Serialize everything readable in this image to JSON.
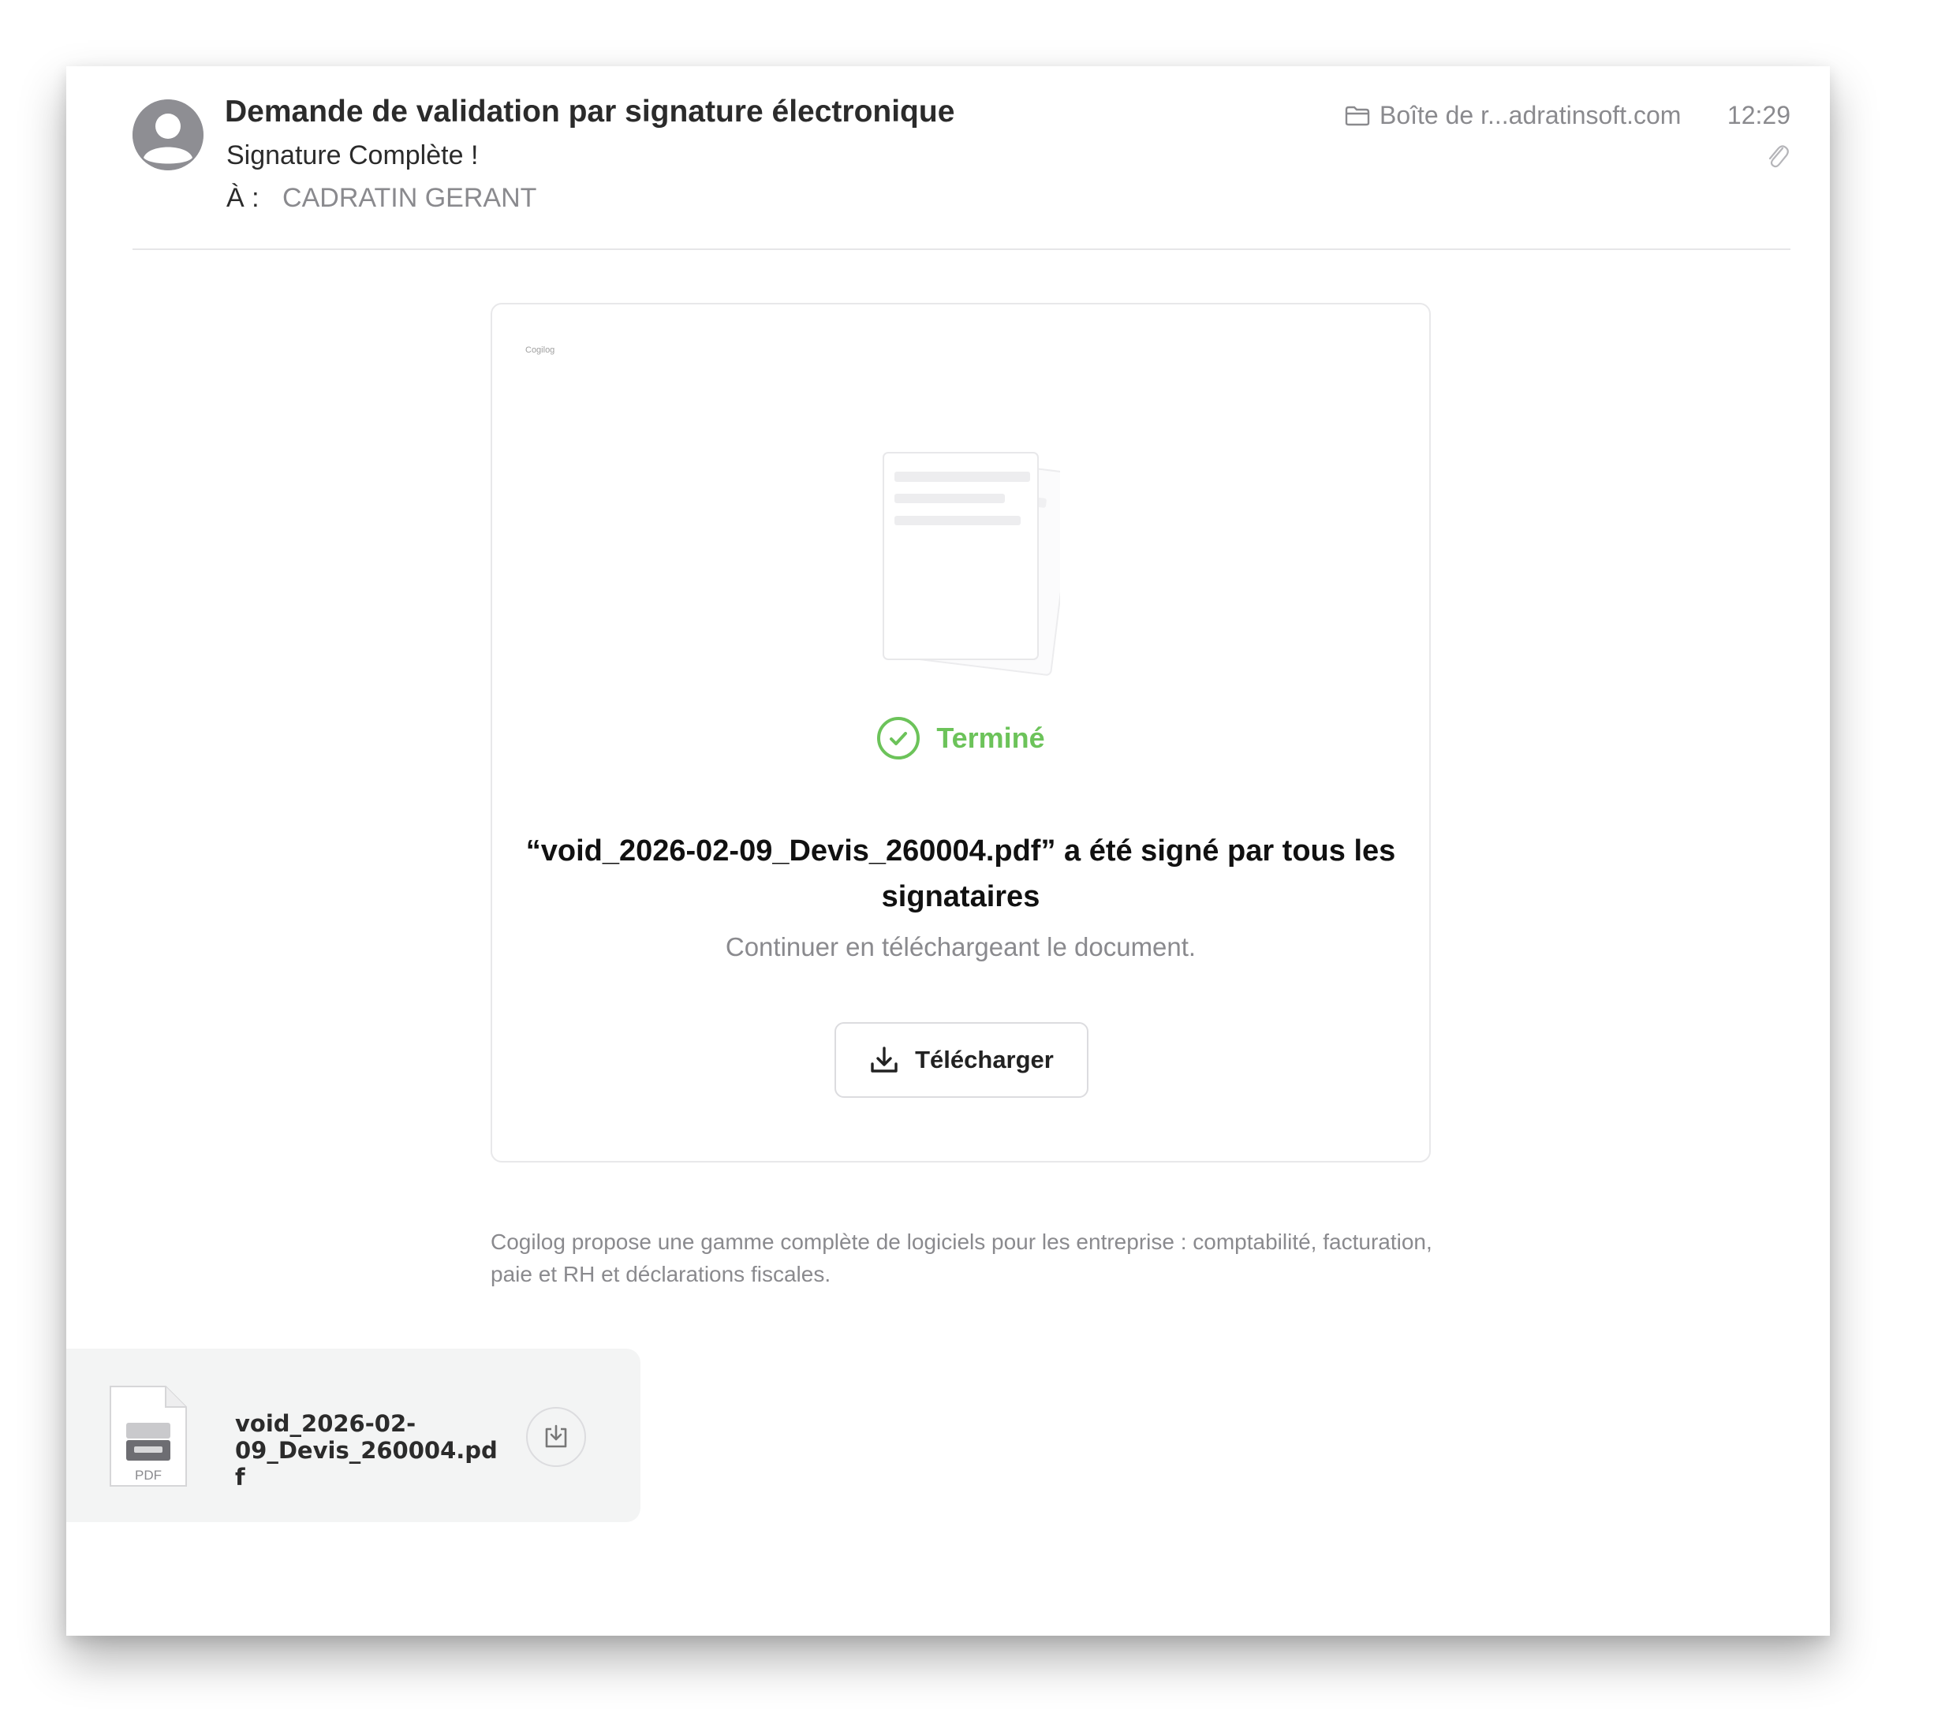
{
  "message_header": {
    "subject": "Demande de validation par signature électronique",
    "sender": "Signature Complète !",
    "to_label": "À :",
    "to_name": "CADRATIN GERANT",
    "mailbox": "Boîte de r...adratinsoft.com",
    "time": "12:29"
  },
  "card": {
    "brand_mark": "Cogilog",
    "status": "Terminé",
    "message": "“void_2026-02-09_Devis_260004.pdf” a été signé par tous les signataires",
    "hint": "Continuer en téléchargeant le document.",
    "download_label": "Télécharger"
  },
  "footer_text": "Cogilog propose une gamme complète de logiciels pour les entreprise : comptabilité, facturation, paie et RH et déclarations fiscales.",
  "attachment": {
    "filename": "void_2026-02-09_Devis_260004.pdf",
    "type_label": "PDF"
  },
  "colors": {
    "success": "#6cc35a",
    "muted_text": "#8a8a8e",
    "border": "#e8e8ea"
  },
  "icons": [
    "avatar-icon",
    "folder-icon",
    "paperclip-icon",
    "documents-illustration",
    "check-circle-icon",
    "download-icon",
    "pdf-file-icon"
  ]
}
